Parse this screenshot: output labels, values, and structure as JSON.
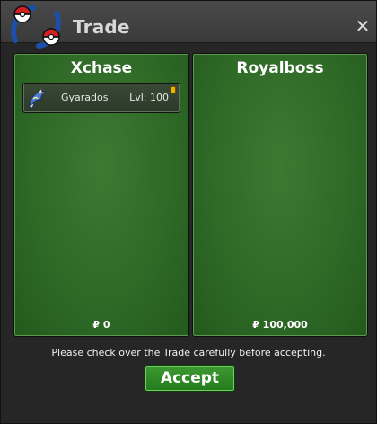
{
  "window": {
    "title": "Trade",
    "close_label": "✕"
  },
  "left_panel": {
    "player_name": "Xchase",
    "items": [
      {
        "name": "Gyarados",
        "level": "Lvl: 100",
        "icon": "gyarados-sprite-icon"
      }
    ],
    "money": "₽ 0"
  },
  "right_panel": {
    "player_name": "Royalboss",
    "items": [],
    "money": "₽ 100,000"
  },
  "footer": {
    "notice": "Please check over the Trade carefully before accepting.",
    "accept_label": "Accept"
  },
  "colors": {
    "panel_green": "#2f6a27",
    "accept_green": "#2f8a26",
    "titlebar": "#444444"
  }
}
